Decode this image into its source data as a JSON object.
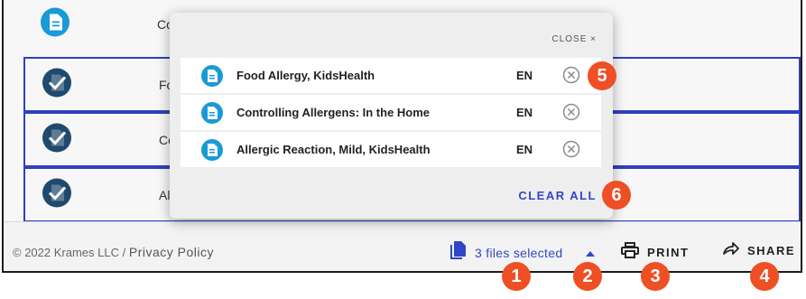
{
  "list": {
    "rows": [
      {
        "text": "Co",
        "selected": false
      },
      {
        "text": "Fo",
        "selected": true
      },
      {
        "text": "Co",
        "selected": true
      },
      {
        "text": "All",
        "selected": true
      }
    ]
  },
  "popup": {
    "close_label": "CLOSE",
    "close_glyph": "×",
    "files": [
      {
        "name": "Food Allergy, KidsHealth",
        "lang": "EN"
      },
      {
        "name": "Controlling Allergens: In the Home",
        "lang": "EN"
      },
      {
        "name": "Allergic Reaction, Mild, KidsHealth",
        "lang": "EN"
      }
    ],
    "clear_all_label": "CLEAR ALL"
  },
  "footer": {
    "copyright": "© 2022 Krames LLC",
    "separator": "/",
    "privacy_label": "Privacy Policy",
    "files_selected_label": "3 files selected",
    "print_label": "PRINT",
    "share_label": "SHARE"
  },
  "badges": [
    "1",
    "2",
    "3",
    "4",
    "5",
    "6"
  ],
  "colors": {
    "accent_blue": "#2f47c5",
    "icon_blue": "#1a9ad6",
    "check_navy": "#1f4a6e",
    "badge_orange": "#ef4f24"
  }
}
